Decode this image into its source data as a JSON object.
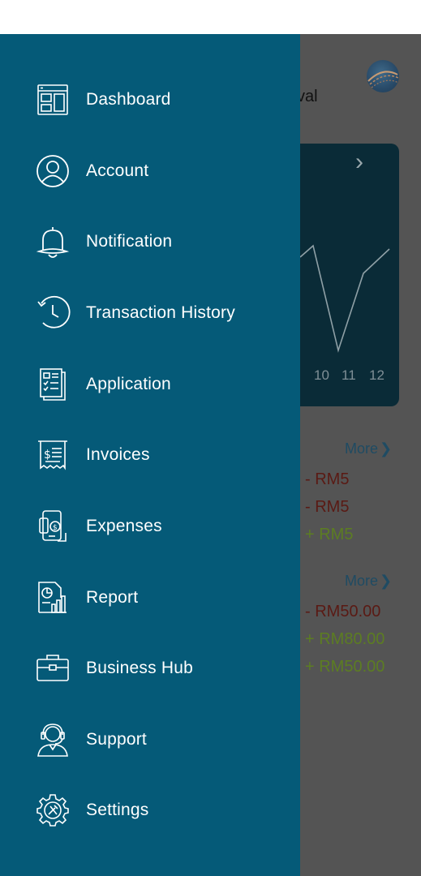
{
  "background": {
    "title_fragment": "val",
    "chart_ticks": [
      "10",
      "11",
      "12"
    ],
    "more_label": "More",
    "section1_amounts": [
      {
        "text": "- RM5",
        "kind": "negative"
      },
      {
        "text": "- RM5",
        "kind": "negative"
      },
      {
        "text": "+ RM5",
        "kind": "positive"
      }
    ],
    "section2_amounts": [
      {
        "text": "- RM50.00",
        "kind": "negative"
      },
      {
        "text": "+ RM80.00",
        "kind": "positive"
      },
      {
        "text": "+ RM50.00",
        "kind": "positive"
      }
    ]
  },
  "drawer": {
    "items": [
      {
        "label": "Dashboard",
        "icon": "dashboard-icon"
      },
      {
        "label": "Account",
        "icon": "user-icon"
      },
      {
        "label": "Notification",
        "icon": "bell-icon"
      },
      {
        "label": "Transaction History",
        "icon": "history-icon"
      },
      {
        "label": "Application",
        "icon": "application-form-icon"
      },
      {
        "label": "Invoices",
        "icon": "invoice-icon"
      },
      {
        "label": "Expenses",
        "icon": "expenses-icon"
      },
      {
        "label": "Report",
        "icon": "report-icon"
      },
      {
        "label": "Business Hub",
        "icon": "briefcase-icon"
      },
      {
        "label": "Support",
        "icon": "support-agent-icon"
      },
      {
        "label": "Settings",
        "icon": "gear-icon"
      }
    ]
  },
  "colors": {
    "drawer_bg": "#055a78",
    "overlay": "#545454",
    "negative": "#5a1a14",
    "positive": "#5c7d22"
  }
}
